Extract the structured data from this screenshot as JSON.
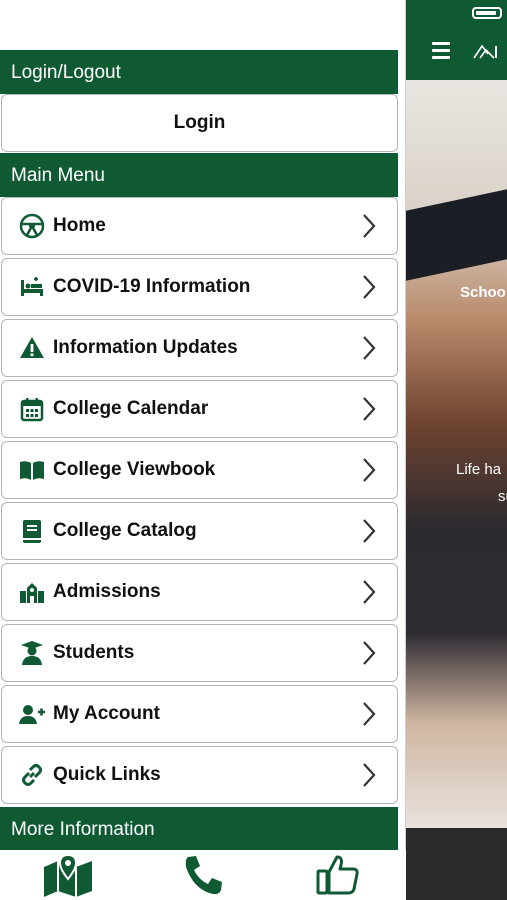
{
  "menu": {
    "login_section": "Login/Logout",
    "login_button": "Login",
    "main_section": "Main Menu",
    "items": [
      {
        "label": "Home",
        "icon": "steering-wheel-icon"
      },
      {
        "label": "COVID-19 Information",
        "icon": "bed-icon"
      },
      {
        "label": "Information Updates",
        "icon": "warning-icon"
      },
      {
        "label": "College Calendar",
        "icon": "calendar-icon"
      },
      {
        "label": "College Viewbook",
        "icon": "open-book-icon"
      },
      {
        "label": "College Catalog",
        "icon": "book-icon"
      },
      {
        "label": "Admissions",
        "icon": "school-building-icon"
      },
      {
        "label": "Students",
        "icon": "graduate-icon"
      },
      {
        "label": "My Account",
        "icon": "add-user-icon"
      },
      {
        "label": "Quick Links",
        "icon": "link-icon"
      }
    ],
    "more_section": "More Information"
  },
  "background": {
    "hero_line1": "Schoo",
    "hero_line2": "Life ha",
    "hero_line3": "su"
  },
  "tabbar": {
    "icons": [
      "map-pin-icon",
      "phone-icon",
      "thumbs-up-icon"
    ]
  },
  "colors": {
    "brand_green": "#0f5a33",
    "item_border": "#b5b5b5"
  }
}
